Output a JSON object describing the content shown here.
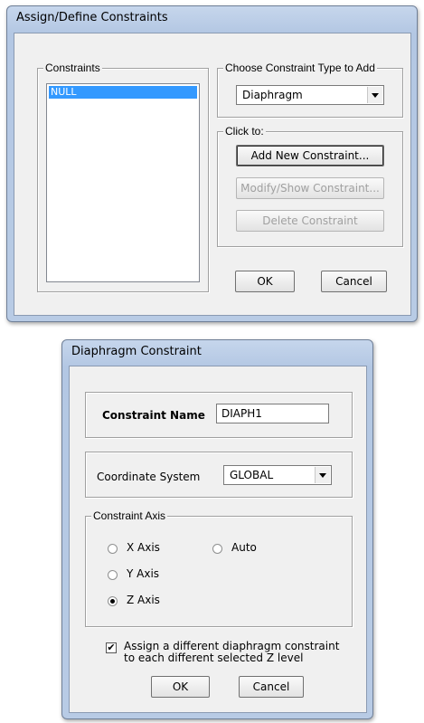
{
  "assign_dialog": {
    "title": "Assign/Define Constraints",
    "constraints_group": "Constraints",
    "constraints_list": [
      "NULL"
    ],
    "choose_group": "Choose Constraint Type to Add",
    "constraint_type": "Diaphragm",
    "click_group": "Click to:",
    "add_button": "Add New Constraint...",
    "modify_button": "Modify/Show Constraint...",
    "delete_button": "Delete Constraint",
    "ok_button": "OK",
    "cancel_button": "Cancel"
  },
  "diaphragm_dialog": {
    "title": "Diaphragm Constraint",
    "name_label": "Constraint Name",
    "name_value": "DIAPH1",
    "coord_label": "Coordinate System",
    "coord_value": "GLOBAL",
    "axis_group": "Constraint Axis",
    "axis_options": {
      "x": "X Axis",
      "y": "Y Axis",
      "z": "Z Axis",
      "auto": "Auto"
    },
    "selected_axis": "Z Axis",
    "assign_checkbox_line1": "Assign a different diaphragm constraint",
    "assign_checkbox_line2": "to each different selected Z level",
    "assign_checked": true,
    "ok_button": "OK",
    "cancel_button": "Cancel"
  }
}
